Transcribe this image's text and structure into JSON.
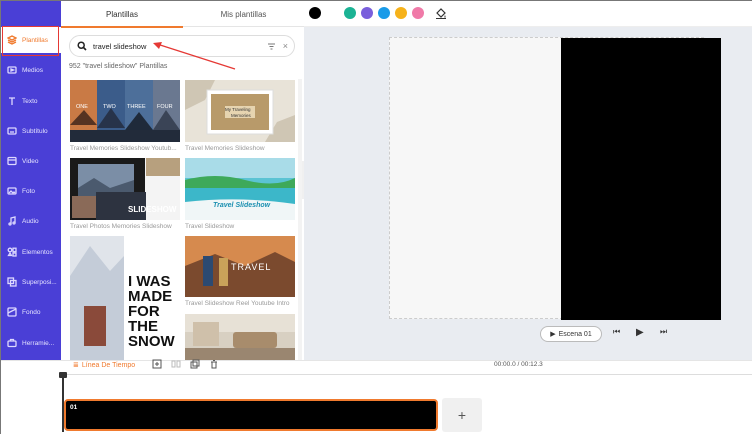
{
  "sidebar": {
    "items": [
      {
        "label": "Plantillas",
        "icon": "layers-icon",
        "active": true
      },
      {
        "label": "Medios",
        "icon": "media-icon"
      },
      {
        "label": "Texto",
        "icon": "text-icon"
      },
      {
        "label": "Subtítulo",
        "icon": "subtitle-icon"
      },
      {
        "label": "Video",
        "icon": "video-icon"
      },
      {
        "label": "Foto",
        "icon": "photo-icon"
      },
      {
        "label": "Audio",
        "icon": "music-icon"
      },
      {
        "label": "Elementos",
        "icon": "elements-icon"
      },
      {
        "label": "Superposi...",
        "icon": "overlay-icon"
      },
      {
        "label": "Fondo",
        "icon": "background-icon"
      },
      {
        "label": "Herramie...",
        "icon": "tools-icon"
      }
    ]
  },
  "panel": {
    "tabs": [
      "Plantillas",
      "Mis plantillas"
    ],
    "search": {
      "value": "travel slideshow"
    },
    "result_count": "952 \"travel slideshow\" Plantillas",
    "templates": [
      {
        "caption": "Travel Memories Slideshow Youtub...",
        "labels": [
          "ONE",
          "TWO",
          "THREE",
          "FOUR"
        ]
      },
      {
        "caption": "Travel Memories Slideshow",
        "labels": [
          "My Traveling",
          "Memories"
        ]
      },
      {
        "caption": "Travel Photos Memories Slideshow",
        "labels": [
          "SLIDESHOW"
        ]
      },
      {
        "caption": "Travel Slideshow",
        "labels": [
          "Travel Slideshow"
        ]
      },
      {
        "caption": "",
        "labels": [
          "I WAS",
          "MADE",
          "FOR",
          "THE",
          "SNOW"
        ]
      },
      {
        "caption": "Travel Slideshow Reel Youtube Intro",
        "labels": [
          "TRAVEL"
        ]
      },
      {
        "caption": "",
        "labels": []
      }
    ]
  },
  "topbar": {
    "colors": [
      "#000000",
      "#1bb394",
      "#7a5fdc",
      "#1a9be8",
      "#f6b21a",
      "#f07aa8"
    ],
    "tool_icon": "fill-bucket-icon"
  },
  "canvas": {
    "scene_label": "Escena 01"
  },
  "timeline": {
    "label": "Línea De Tiempo",
    "time": "00:00.0 / 00:12.3",
    "clip_label": "01",
    "add_label": "+"
  },
  "colors": {
    "accent": "#f07a2e",
    "sidebar": "#4a3fd6"
  }
}
